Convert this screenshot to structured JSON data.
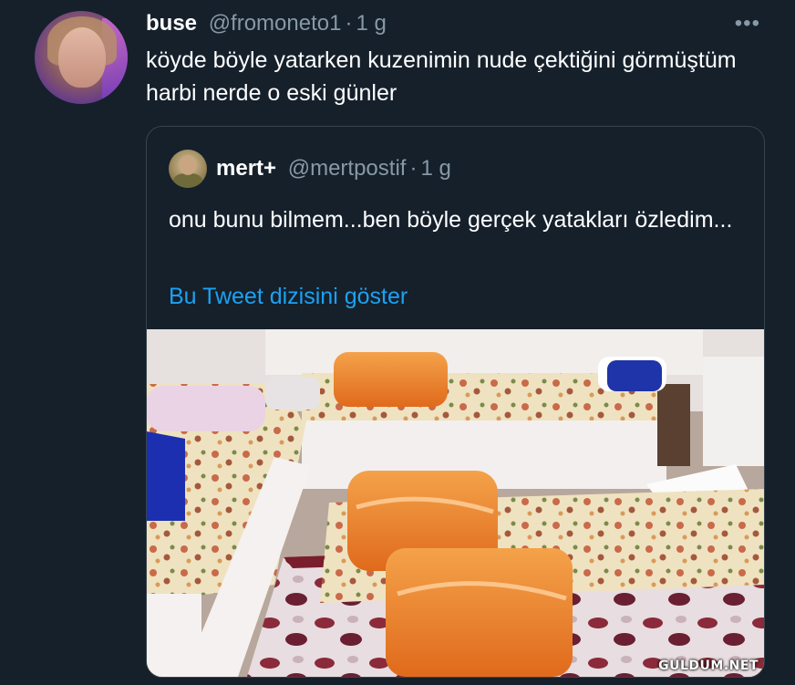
{
  "tweet": {
    "display_name": "buse",
    "handle": "@fromoneto1",
    "separator": "·",
    "time": "1 g",
    "more": "•••",
    "text": "köyde böyle yatarken kuzenimin nude çektiğini görmüştüm harbi nerde o eski günler"
  },
  "quoted": {
    "display_name": "mert+",
    "handle": "@mertpostif",
    "separator": "·",
    "time": "1 g",
    "text": "onu bunu bilmem...ben böyle gerçek yatakları özledim...",
    "thread_link": "Bu Tweet dizisini göster"
  },
  "watermark": "GULDUM.NET",
  "colors": {
    "background": "#15202b",
    "secondary_text": "#8899a6",
    "link": "#1da1f2",
    "border": "#38444d"
  }
}
